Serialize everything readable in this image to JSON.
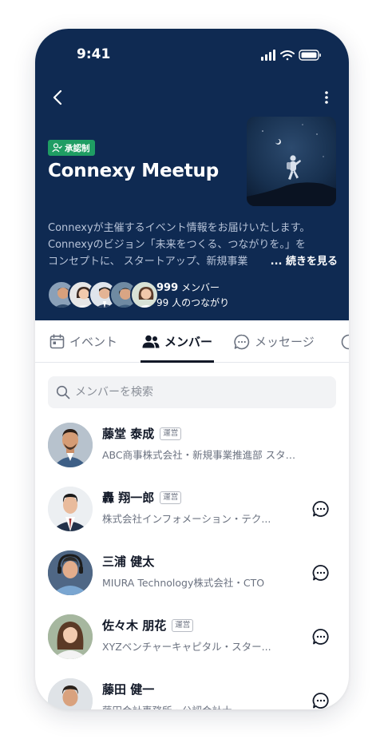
{
  "status": {
    "time": "9:41"
  },
  "group": {
    "badge_label": "承認制",
    "title": "Connexy Meetup",
    "description_lines": [
      "Connexyが主催するイベント情報をお届けいたします。",
      "Connexyのビジョン「未来をつくる、つながりを。」を",
      "コンセプトに、 スタートアップ、新規事業"
    ],
    "read_more": "... 続きを見る",
    "member_count": "999",
    "member_suffix": "メンバー",
    "connection_count": "99",
    "connection_suffix": "人のつながり"
  },
  "tabs": [
    {
      "label": "イベント",
      "icon": "calendar-icon"
    },
    {
      "label": "メンバー",
      "icon": "users-icon",
      "active": true
    },
    {
      "label": "メッセージ",
      "icon": "chat-bubble-icon"
    }
  ],
  "search": {
    "placeholder": "メンバーを検索"
  },
  "members": [
    {
      "name": "藤堂 泰成",
      "role": "運営",
      "org": "ABC商事株式会社・新規事業推進部 スター...",
      "show_chat": false
    },
    {
      "name": "轟 翔一郎",
      "role": "運営",
      "org": "株式会社インフォメーション・テク...",
      "show_chat": true
    },
    {
      "name": "三浦 健太",
      "role": "",
      "org": "MIURA Technology株式会社・CTO",
      "show_chat": true
    },
    {
      "name": "佐々木 朋花",
      "role": "運営",
      "org": "XYZベンチャーキャピタル・スター...",
      "show_chat": true
    },
    {
      "name": "藤田 健一",
      "role": "",
      "org": "藤田会計事務所・公認会計士",
      "show_chat": true
    }
  ],
  "colors": {
    "hero_bg": "#0f2a52",
    "badge_bg": "#1f9d63",
    "active_tab": "#111827"
  }
}
